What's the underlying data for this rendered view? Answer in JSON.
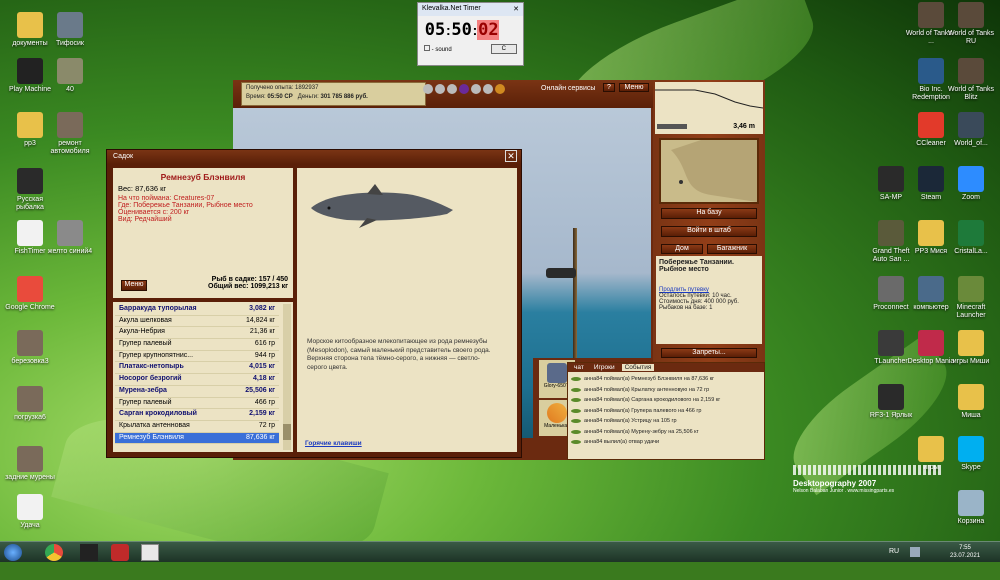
{
  "desktop_left": [
    {
      "label": "документы",
      "color": "#e8c14a"
    },
    {
      "label": "Тифосик",
      "color": "#6a7a8a"
    },
    {
      "label": "Play Machine",
      "color": "#222"
    },
    {
      "label": "40",
      "color": "#8a8a6a"
    },
    {
      "label": "pp3",
      "color": "#e8c14a"
    },
    {
      "label": "ремонт автомобиля",
      "color": "#7a6a5a"
    },
    {
      "label": "Русская рыбалка",
      "color": "#2a2a2a"
    },
    {
      "label": "FishTimer",
      "color": "#f2f2f2"
    },
    {
      "label": "желто синий4",
      "color": "#8a8a8a"
    },
    {
      "label": "Google Chrome",
      "color": "#e94b3c"
    },
    {
      "label": "березовка3",
      "color": "#7a6a5a"
    },
    {
      "label": "погрузка6",
      "color": "#7a6a5a"
    },
    {
      "label": "задние мурены",
      "color": "#7a6a5a"
    },
    {
      "label": "Удача",
      "color": "#f2f2f2"
    }
  ],
  "desktop_right": [
    {
      "label": "World of Tanks - ...",
      "color": "#5a4a3a"
    },
    {
      "label": "World of Tanks RU",
      "color": "#5a4a3a"
    },
    {
      "label": "Bio Inc. Redemption",
      "color": "#2a5a8a"
    },
    {
      "label": "World of Tanks Blitz",
      "color": "#5a4a3a"
    },
    {
      "label": "CCleaner",
      "color": "#e23a2a"
    },
    {
      "label": "World_of...",
      "color": "#3a4a5a"
    },
    {
      "label": "SA-MP",
      "color": "#2a2a2a"
    },
    {
      "label": "Steam",
      "color": "#1b2838"
    },
    {
      "label": "Zoom",
      "color": "#2d8cff"
    },
    {
      "label": "Grand Theft Auto San ...",
      "color": "#5a5a3a"
    },
    {
      "label": "PP3 Мися",
      "color": "#e8c14a"
    },
    {
      "label": "CristalLa...",
      "color": "#1e7a3a"
    },
    {
      "label": "Proconnect",
      "color": "#6a6a6a"
    },
    {
      "label": "компьютер",
      "color": "#4a6a8a"
    },
    {
      "label": "Minecraft Launcher",
      "color": "#6a8a3a"
    },
    {
      "label": "TLauncher",
      "color": "#3a3a3a"
    },
    {
      "label": "Desktop Mania",
      "color": "#c02a4a"
    },
    {
      "label": "игры Миши",
      "color": "#e8c14a"
    },
    {
      "label": "RF3-1 Ярлык",
      "color": "#2a2a2a"
    },
    {
      "label": "Миша",
      "color": "#e8c14a"
    },
    {
      "label": "игры",
      "color": "#e8c14a"
    },
    {
      "label": "Skype",
      "color": "#00aff0"
    },
    {
      "label": "Корзина",
      "color": "#9ab4c8"
    }
  ],
  "timer": {
    "title": "Klevalka.Net Timer",
    "hh": "05",
    "mm": "50",
    "ss": "02",
    "sound_label": "- sound",
    "button": "C"
  },
  "game_top": {
    "experience": "Получено опыта: 1892937",
    "time_label": "Время:",
    "time": "05:50 СР",
    "money_label": "Деньги:",
    "money": "301 785 886 руб.",
    "services": "Онлайн сервисы",
    "help": "?",
    "menu": "Меню"
  },
  "depth": "3,46 m",
  "side": {
    "to_base": "На базу",
    "login": "Войти в штаб",
    "home": "Дом",
    "luggage": "Багажник",
    "location": "Побережье Танзании. Рыбное место",
    "extend": "Продлить путевку",
    "trip_left": "Осталось путевки: 10 час.",
    "day_cost": "Стоимость дня: 400 000 руб.",
    "fishers": "Рыбаков на базе: 1",
    "bans": "Запреты..."
  },
  "tackle": [
    {
      "label": "Glory-650TI"
    },
    {
      "label": "Маленькая"
    }
  ],
  "chat": {
    "tabs": [
      "чат",
      "Игроки",
      "События"
    ],
    "lines": [
      "анна84 поймал(а) Ремнезуб Блэнвиля на 87,636 кг",
      "анна84 поймал(а) Крылатку антенновую на 72 гр",
      "анна84 поймал(а) Саргана крокодилового на 2,159 кг",
      "анна84 поймал(а) Групера палевого на 466 гр",
      "анна84 поймал(а) Устрицу на 105 гр",
      "анна84 поймал(а) Мурену-зебру на 25,506 кг",
      "анна84 вылил(а) отвар удачи"
    ]
  },
  "dialog": {
    "title": "Садок",
    "fish_name": "Ремнезуб Блэнвиля",
    "weight": "Вес: 87,636 кг",
    "bait": "На что поймана: Creatures-07",
    "where": "Где: Побережье Танзании, Рыбное место",
    "value": "Оценивается с: 200 кг",
    "kind": "Вид: Редчайший",
    "menu": "Меню",
    "in_keep": "Рыб в садке: 157 / 450",
    "total": "Общий вес: 1099,213 кг",
    "description": "Морское китообразное млекопитающее из рода ремнезубы (Mesoplodon), самый маленький представитель своего рода. Верхняя сторона тела тёмно-серого, а нижняя — светло-серого цвета.",
    "hotkeys": "Горячие клавиши",
    "list": [
      {
        "name": "Барракуда тупорылая",
        "w": "3,082 кг",
        "bold": true
      },
      {
        "name": "Акула шелковая",
        "w": "14,824 кг",
        "bold": false
      },
      {
        "name": "Акула-Небрия",
        "w": "21,36 кг",
        "bold": false
      },
      {
        "name": "Групер палевый",
        "w": "616 гр",
        "bold": false
      },
      {
        "name": "Групер крупнопятнис...",
        "w": "944 гр",
        "bold": false
      },
      {
        "name": "Платакс-нетопырь",
        "w": "4,015 кг",
        "bold": true
      },
      {
        "name": "Носорог безрогий",
        "w": "4,18 кг",
        "bold": true
      },
      {
        "name": "Мурена-зебра",
        "w": "25,506 кг",
        "bold": true
      },
      {
        "name": "Групер палевый",
        "w": "466 гр",
        "bold": false
      },
      {
        "name": "Сарган крокодиловый",
        "w": "2,159 кг",
        "bold": true
      },
      {
        "name": "Крылатка антенновая",
        "w": "72 гр",
        "bold": false
      },
      {
        "name": "Ремнезуб Блэнвиля",
        "w": "87,636 кг",
        "bold": false,
        "sel": true
      }
    ]
  },
  "watermark": {
    "title": "Desktopography 2007",
    "sub": "Nelson Balaban Junior . www.missingparts.es"
  },
  "taskbar": {
    "lang": "RU",
    "time": "7:55",
    "date": "23.07.2021"
  }
}
